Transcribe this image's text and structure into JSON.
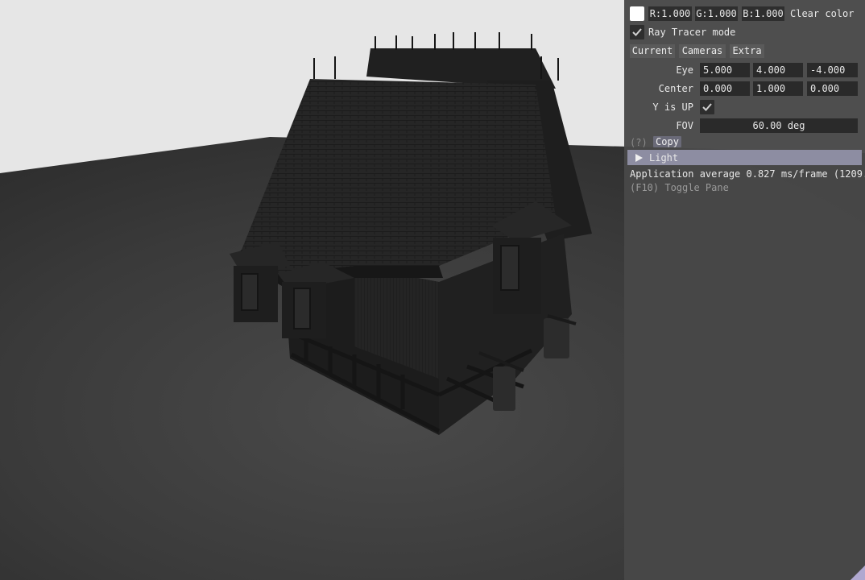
{
  "clear_color": {
    "r_label": "R:1.000",
    "g_label": "G:1.000",
    "b_label": "B:1.000",
    "label": "Clear color",
    "swatch_color": "#ffffff"
  },
  "ray_tracer": {
    "label": "Ray Tracer mode",
    "checked": true
  },
  "tabs": [
    "Current",
    "Cameras",
    "Extra"
  ],
  "camera": {
    "eye_label": "Eye",
    "eye": [
      "5.000",
      "4.000",
      "-4.000"
    ],
    "center_label": "Center",
    "center": [
      "0.000",
      "1.000",
      "0.000"
    ],
    "yup_label": "Y is UP",
    "yup_checked": true,
    "fov_label": "FOV",
    "fov_value": "60.00 deg"
  },
  "help_label": "(?)",
  "copy_label": "Copy",
  "light_header": "Light",
  "stats_text": "Application average 0.827 ms/frame (1209.",
  "toggle_text": "(F10) Toggle Pane",
  "colors": {
    "panel_bg": "#484848",
    "header_accent": "#8d8da2",
    "sky": "#e6e6e6",
    "floor": "#3c3c3c"
  }
}
